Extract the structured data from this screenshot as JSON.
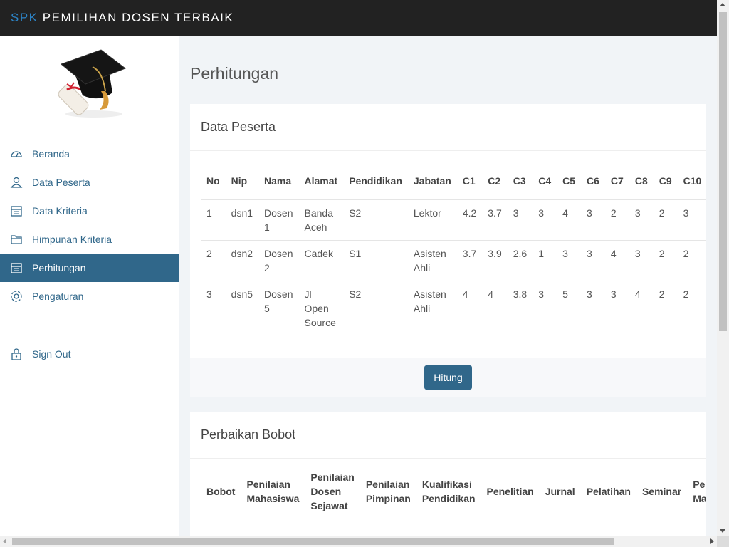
{
  "brand": {
    "accent": "SPK",
    "title": "PEMILIHAN DOSEN TERBAIK"
  },
  "sidebar": {
    "items": [
      {
        "label": "Beranda",
        "icon": "dashboard-icon"
      },
      {
        "label": "Data Peserta",
        "icon": "user-icon"
      },
      {
        "label": "Data Kriteria",
        "icon": "calendar-icon"
      },
      {
        "label": "Himpunan Kriteria",
        "icon": "folder-icon"
      },
      {
        "label": "Perhitungan",
        "icon": "calendar-icon",
        "active": true
      },
      {
        "label": "Pengaturan",
        "icon": "gear-icon"
      }
    ],
    "signout": {
      "label": "Sign Out",
      "icon": "lock-icon"
    }
  },
  "page": {
    "title": "Perhitungan"
  },
  "peserta": {
    "heading": "Data Peserta",
    "columns": [
      "No",
      "Nip",
      "Nama",
      "Alamat",
      "Pendidikan",
      "Jabatan",
      "C1",
      "C2",
      "C3",
      "C4",
      "C5",
      "C6",
      "C7",
      "C8",
      "C9",
      "C10"
    ],
    "rows": [
      [
        "1",
        "dsn1",
        "Dosen 1",
        "Banda Aceh",
        "S2",
        "Lektor",
        "4.2",
        "3.7",
        "3",
        "3",
        "4",
        "3",
        "2",
        "3",
        "2",
        "3"
      ],
      [
        "2",
        "dsn2",
        "Dosen 2",
        "Cadek",
        "S1",
        "Asisten Ahli",
        "3.7",
        "3.9",
        "2.6",
        "1",
        "3",
        "3",
        "4",
        "3",
        "2",
        "2"
      ],
      [
        "3",
        "dsn5",
        "Dosen 5",
        "Jl Open Source",
        "S2",
        "Asisten Ahli",
        "4",
        "4",
        "3.8",
        "3",
        "5",
        "3",
        "3",
        "4",
        "2",
        "2"
      ]
    ],
    "button": "Hitung"
  },
  "bobot": {
    "heading": "Perbaikan Bobot",
    "columns": [
      "Bobot",
      "Penilaian Mahasiswa",
      "Penilaian Dosen Sejawat",
      "Penilaian Pimpinan",
      "Kualifikasi Pendidikan",
      "Penelitian",
      "Jurnal",
      "Pelatihan",
      "Seminar",
      "Penilaian Masyarakat"
    ]
  },
  "colors": {
    "topbar": "#222222",
    "accent": "#30678a",
    "brandAccent": "#30a5ff",
    "background": "#f1f4f7"
  }
}
